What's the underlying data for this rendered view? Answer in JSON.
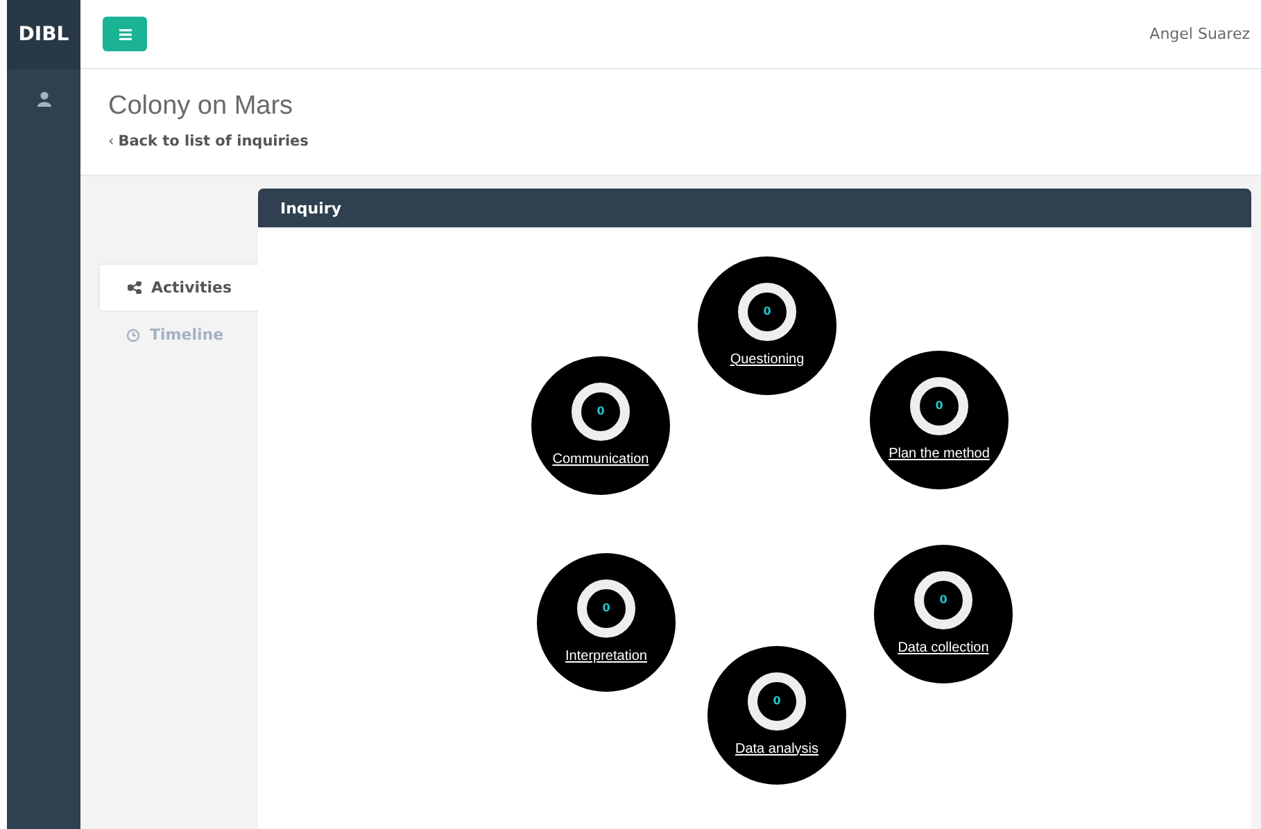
{
  "sidebar": {
    "brand": "DIBL"
  },
  "topbar": {
    "user": "Angel Suarez"
  },
  "header": {
    "title": "Colony on Mars",
    "back_chevron": "‹",
    "back_link": "Back to list of inquiries"
  },
  "tabs": [
    {
      "label": "Activities",
      "selected": true
    },
    {
      "label": "Timeline",
      "selected": false
    }
  ],
  "panel": {
    "title": "Inquiry",
    "phases": [
      {
        "label": "Questioning",
        "count": "0"
      },
      {
        "label": "Communication",
        "count": "0"
      },
      {
        "label": "Plan the method",
        "count": "0"
      },
      {
        "label": "Interpretation",
        "count": "0"
      },
      {
        "label": "Data collection",
        "count": "0"
      },
      {
        "label": "Data analysis",
        "count": "0"
      }
    ]
  }
}
